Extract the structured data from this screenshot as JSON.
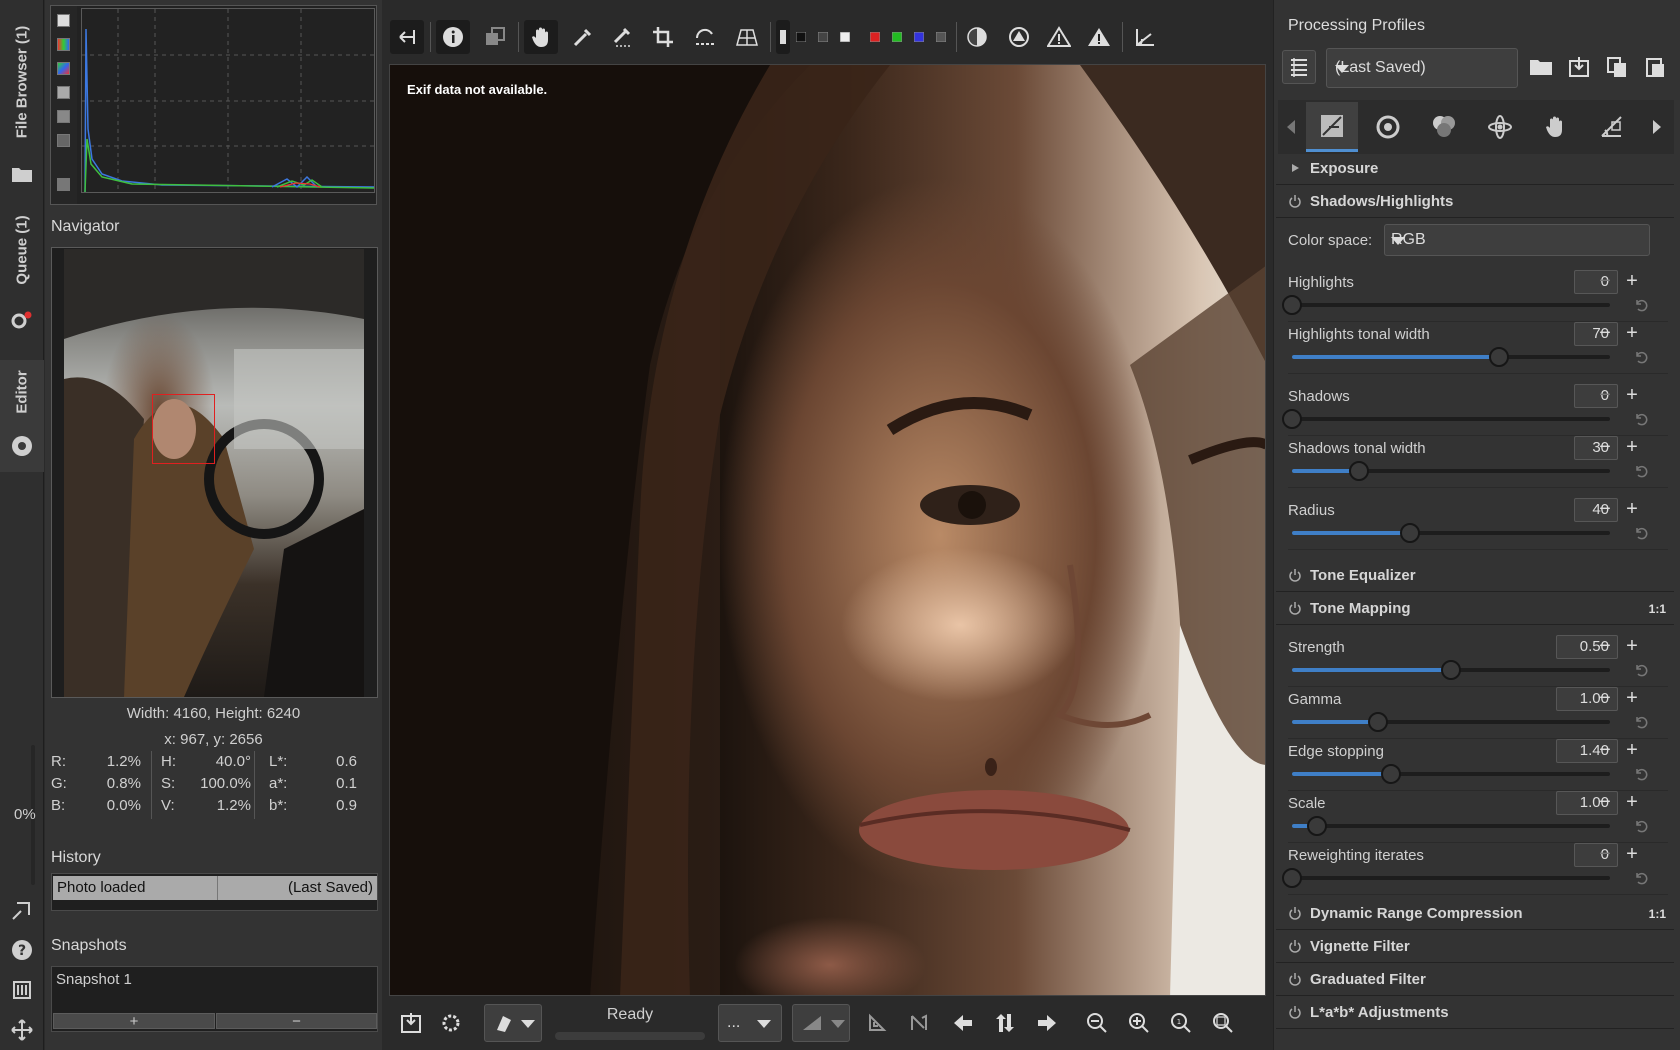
{
  "vtabs": {
    "file_browser": "File Browser (1)",
    "queue": "Queue (1)",
    "editor": "Editor",
    "zoom_percent": "0%"
  },
  "navigator": {
    "title": "Navigator",
    "dimensions": "Width: 4160, Height: 6240",
    "coords": "x: 967, y: 2656",
    "pixel": {
      "r_label": "R:",
      "r_val": "1.2%",
      "g_label": "G:",
      "g_val": "0.8%",
      "b_label": "B:",
      "b_val": "0.0%",
      "h_label": "H:",
      "h_val": "40.0°",
      "s_label": "S:",
      "s_val": "100.0%",
      "v_label": "V:",
      "v_val": "1.2%",
      "l_label": "L*:",
      "l_val": "0.6",
      "a_label": "a*:",
      "a_val": "0.1",
      "bb_label": "b*:",
      "bb_val": "0.9"
    }
  },
  "history": {
    "title": "History",
    "entry_action": "Photo loaded",
    "entry_profile": "(Last Saved)"
  },
  "snapshots": {
    "title": "Snapshots",
    "item": "Snapshot 1",
    "add": "+",
    "remove": "−"
  },
  "canvas": {
    "exif": "Exif data not available."
  },
  "bottom": {
    "status": "Ready",
    "combo_value": "..."
  },
  "right": {
    "title": "Processing Profiles",
    "profile": "(Last Saved)",
    "sections": {
      "exposure": "Exposure",
      "shadows_highlights": "Shadows/Highlights",
      "tone_equalizer": "Tone Equalizer",
      "tone_mapping": "Tone Mapping",
      "drc": "Dynamic Range Compression",
      "vignette": "Vignette Filter",
      "graduated": "Graduated Filter",
      "lab": "L*a*b* Adjustments",
      "badge_tm": "1:1",
      "badge_drc": "1:1"
    },
    "color_space_label": "Color space:",
    "color_space": "RGB",
    "sh_params": [
      {
        "label": "Highlights",
        "value": "0",
        "pos": 0.0
      },
      {
        "label": "Highlights tonal width",
        "value": "70",
        "pos": 0.65
      },
      {
        "label": "Shadows",
        "value": "0",
        "pos": 0.0
      },
      {
        "label": "Shadows tonal width",
        "value": "30",
        "pos": 0.21
      },
      {
        "label": "Radius",
        "value": "40",
        "pos": 0.37
      }
    ],
    "tm_params": [
      {
        "label": "Strength",
        "value": "0.50",
        "pos": 0.5
      },
      {
        "label": "Gamma",
        "value": "1.00",
        "pos": 0.27
      },
      {
        "label": "Edge stopping",
        "value": "1.40",
        "pos": 0.31
      },
      {
        "label": "Scale",
        "value": "1.00",
        "pos": 0.08
      },
      {
        "label": "Reweighting iterates",
        "value": "0",
        "pos": 0.0
      }
    ]
  },
  "colors": {
    "accent": "#3f7fc7",
    "panel": "#333333",
    "background": "#2a2a2a",
    "nav_box": "#e02020"
  }
}
